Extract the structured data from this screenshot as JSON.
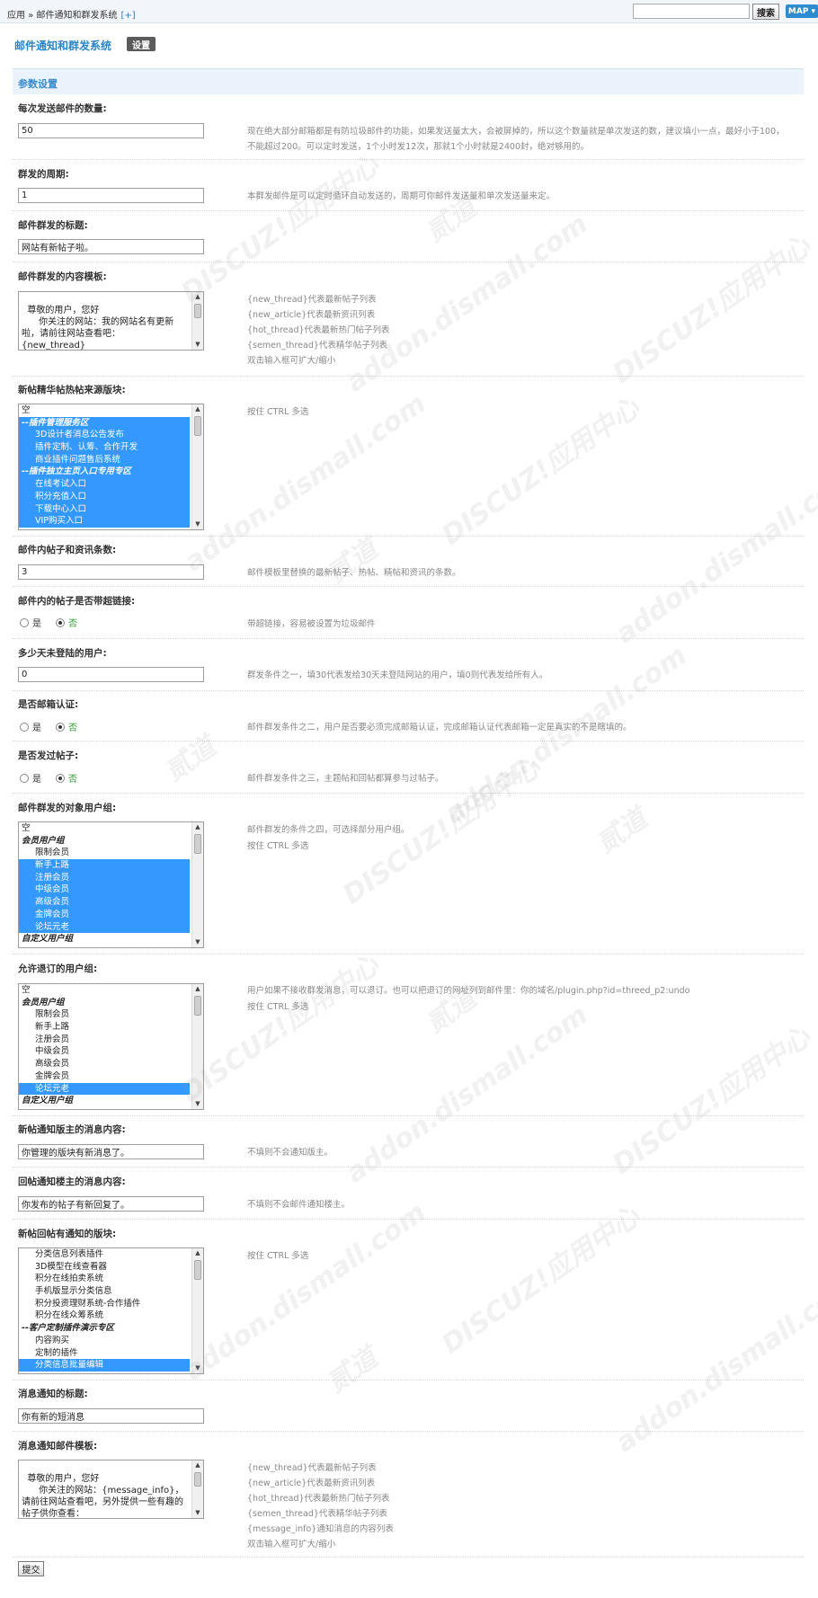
{
  "topbar": {
    "breadcrumb": "应用 » 邮件通知和群发系统",
    "add_label": "[+]",
    "search_value": "",
    "search_button": "搜索",
    "map_button": "MAP ▾"
  },
  "header": {
    "title": "邮件通知和群发系统",
    "tab_settings": "设置"
  },
  "section_title": "参数设置",
  "fields": {
    "batch_count": {
      "label": "每次发送邮件的数量:",
      "value": "50",
      "tip1": "现在绝大部分邮箱都是有防垃圾邮件的功能，如果发送量太大，会被屏掉的，所以这个数量就是单次发送的数，建议填小一点，最好小于100，",
      "tip2": "不能超过200。可以定时发送，1个小时发12次，那就1个小时就是2400封，绝对够用的。"
    },
    "cycle": {
      "label": "群发的周期:",
      "value": "1",
      "tip": "本群发邮件是可以定时循环自动发送的，周期可你邮件发送量和单次发送量来定。"
    },
    "subject": {
      "label": "邮件群发的标题:",
      "value": "网站有新帖子啦。"
    },
    "template": {
      "label": "邮件群发的内容模板:",
      "value": "尊敬的用户，您好\n      你关注的网站：我的网站名有更新啦，请前往网站查看吧：\n{new_thread}\n{hot_thread}",
      "tips": [
        "{new_thread}代表最新帖子列表",
        "{new_article}代表最新资讯列表",
        "{hot_thread}代表最新热门帖子列表",
        "{semen_thread}代表精华帖子列表",
        "双击输入框可扩大/缩小"
      ]
    },
    "source_forums": {
      "label": "新帖精华帖热帖来源版块:",
      "tip": "按住 CTRL 多选",
      "options": [
        {
          "text": "空",
          "kind": "plain",
          "sel": false
        },
        {
          "text": "--插件管理服务区",
          "kind": "group",
          "sel": true
        },
        {
          "text": "3D设计者消息公告发布",
          "kind": "child",
          "sel": true
        },
        {
          "text": "插件定制、认筹、合作开发",
          "kind": "child",
          "sel": true
        },
        {
          "text": "商业插件问题售后系统",
          "kind": "child",
          "sel": true
        },
        {
          "text": "--插件独立主页入口专用专区",
          "kind": "group",
          "sel": true
        },
        {
          "text": "在线考试入口",
          "kind": "child",
          "sel": true
        },
        {
          "text": "积分充值入口",
          "kind": "child",
          "sel": true
        },
        {
          "text": "下载中心入口",
          "kind": "child",
          "sel": true
        },
        {
          "text": "VIP购买入口",
          "kind": "child",
          "sel": true
        }
      ]
    },
    "item_count": {
      "label": "邮件内帖子和资讯条数:",
      "value": "3",
      "tip": "邮件模板里替换的最新帖子、热帖、精帖和资讯的条数。"
    },
    "hyperlink": {
      "label": "邮件内的帖子是否带超链接:",
      "yes": "是",
      "no": "否",
      "tip": "带超链接，容易被设置为垃圾邮件"
    },
    "inactive_days": {
      "label": "多少天未登陆的用户:",
      "value": "0",
      "tip": "群发条件之一，填30代表发给30天未登陆网站的用户，填0则代表发给所有人。"
    },
    "email_verified": {
      "label": "是否邮箱认证:",
      "yes": "是",
      "no": "否",
      "tip": "邮件群发条件之二，用户是否要必须完成邮箱认证，完成邮箱认证代表邮箱一定是真实的不是瞎填的。"
    },
    "has_posted": {
      "label": "是否发过帖子:",
      "yes": "是",
      "no": "否",
      "tip": "邮件群发条件之三，主题帖和回帖都算参与过帖子。"
    },
    "target_groups": {
      "label": "邮件群发的对象用户组:",
      "tip1": "邮件群发的条件之四，可选择部分用户组。",
      "tip2": "按住 CTRL 多选",
      "options": [
        {
          "text": "空",
          "kind": "plain",
          "sel": false
        },
        {
          "text": "会员用户组",
          "kind": "group",
          "sel": false
        },
        {
          "text": "限制会员",
          "kind": "child",
          "sel": false
        },
        {
          "text": "新手上路",
          "kind": "child",
          "sel": true
        },
        {
          "text": "注册会员",
          "kind": "child",
          "sel": true
        },
        {
          "text": "中级会员",
          "kind": "child",
          "sel": true
        },
        {
          "text": "高级会员",
          "kind": "child",
          "sel": true
        },
        {
          "text": "金牌会员",
          "kind": "child",
          "sel": true
        },
        {
          "text": "论坛元老",
          "kind": "child",
          "sel": true
        },
        {
          "text": "自定义用户组",
          "kind": "group",
          "sel": false
        }
      ]
    },
    "unsubscribe_groups": {
      "label": "允许退订的用户组:",
      "tip1": "用户如果不接收群发消息，可以退订。也可以把退订的网址列到邮件里：你的域名/plugin.php?id=threed_p2:undo",
      "tip2": "按住 CTRL 多选",
      "options": [
        {
          "text": "空",
          "kind": "plain",
          "sel": false
        },
        {
          "text": "会员用户组",
          "kind": "group",
          "sel": false
        },
        {
          "text": "限制会员",
          "kind": "child",
          "sel": false
        },
        {
          "text": "新手上路",
          "kind": "child",
          "sel": false
        },
        {
          "text": "注册会员",
          "kind": "child",
          "sel": false
        },
        {
          "text": "中级会员",
          "kind": "child",
          "sel": false
        },
        {
          "text": "高级会员",
          "kind": "child",
          "sel": false
        },
        {
          "text": "金牌会员",
          "kind": "child",
          "sel": false
        },
        {
          "text": "论坛元老",
          "kind": "child",
          "sel": true
        },
        {
          "text": "自定义用户组",
          "kind": "group",
          "sel": false
        }
      ]
    },
    "notify_moderator": {
      "label": "新帖通知版主的消息内容:",
      "value": "你管理的版块有新消息了。",
      "tip": "不填则不会通知版主。"
    },
    "notify_author": {
      "label": "回帖通知楼主的消息内容:",
      "value": "你发布的帖子有新回复了。",
      "tip": "不填则不会邮件通知楼主。"
    },
    "notify_forums": {
      "label": "新帖回帖有通知的版块:",
      "tip": "按住 CTRL 多选",
      "options": [
        {
          "text": "分类信息列表插件",
          "kind": "child",
          "sel": false
        },
        {
          "text": "3D模型在线查看器",
          "kind": "child",
          "sel": false
        },
        {
          "text": "积分在线拍卖系统",
          "kind": "child",
          "sel": false
        },
        {
          "text": "手机版显示分类信息",
          "kind": "child",
          "sel": false
        },
        {
          "text": "积分投资理财系统-合作插件",
          "kind": "child",
          "sel": false
        },
        {
          "text": "积分在线众筹系统",
          "kind": "child",
          "sel": false
        },
        {
          "text": "--客户定制插件演示专区",
          "kind": "group",
          "sel": false
        },
        {
          "text": "内容购买",
          "kind": "child",
          "sel": false
        },
        {
          "text": "定制的插件",
          "kind": "child",
          "sel": false
        },
        {
          "text": "分类信息批量编辑",
          "kind": "child",
          "sel": true
        }
      ]
    },
    "msg_subject": {
      "label": "消息通知的标题:",
      "value": "你有新的短消息"
    },
    "msg_template": {
      "label": "消息通知邮件模板:",
      "value": "尊敬的用户，您好\n      你关注的网站：{message_info}，请前往网站查看吧，另外提供一些有趣的帖子供你查看：\n{new_thread}",
      "tips": [
        "{new_thread}代表最新帖子列表",
        "{new_article}代表最新资讯列表",
        "{hot_thread}代表最新热门帖子列表",
        "{semen_thread}代表精华帖子列表",
        "{message_info}通知消息的内容列表",
        "双击输入框可扩大/缩小"
      ]
    }
  },
  "submit_label": "提交",
  "watermark_texts": [
    "DISCUZ!应用中心",
    "addon.dismall.com",
    "贰道"
  ]
}
